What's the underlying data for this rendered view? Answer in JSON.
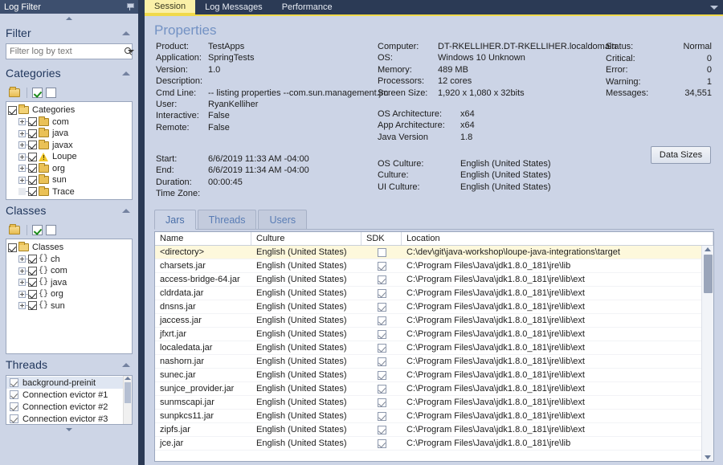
{
  "left_panel": {
    "title": "Log Filter",
    "pin_icon": "pin-icon",
    "sections": {
      "filter": {
        "title": "Filter",
        "search_placeholder": "Filter log by text",
        "search_value": "",
        "search_icon": "magnifier-icon",
        "dropdown_icon": "chevron-down-icon"
      },
      "categories": {
        "title": "Categories",
        "toolbar": {
          "folder_icon": "folder-icon",
          "check_all_icon": "check-all-icon",
          "uncheck_all_icon": "uncheck-all-icon"
        },
        "root": {
          "label": "Categories",
          "checked": true,
          "icon": "folder-open-icon"
        },
        "items": [
          {
            "label": "com",
            "checked": true,
            "icon": "folder-icon",
            "expandable": true
          },
          {
            "label": "java",
            "checked": true,
            "icon": "folder-icon",
            "expandable": true
          },
          {
            "label": "javax",
            "checked": true,
            "icon": "folder-icon",
            "expandable": true
          },
          {
            "label": "Loupe",
            "checked": true,
            "icon": "warning-icon",
            "expandable": true
          },
          {
            "label": "org",
            "checked": true,
            "icon": "folder-icon",
            "expandable": true
          },
          {
            "label": "sun",
            "checked": true,
            "icon": "folder-icon",
            "expandable": true
          },
          {
            "label": "Trace",
            "checked": true,
            "icon": "folder-icon",
            "expandable": false
          }
        ]
      },
      "classes": {
        "title": "Classes",
        "toolbar": {
          "folder_icon": "folder-icon",
          "check_all_icon": "check-all-icon",
          "uncheck_all_icon": "uncheck-all-icon"
        },
        "root": {
          "label": "Classes",
          "checked": true,
          "icon": "folder-open-icon"
        },
        "items": [
          {
            "label": "ch",
            "checked": true,
            "icon": "namespace-icon",
            "expandable": true
          },
          {
            "label": "com",
            "checked": true,
            "icon": "namespace-icon",
            "expandable": true
          },
          {
            "label": "java",
            "checked": true,
            "icon": "namespace-icon",
            "expandable": true
          },
          {
            "label": "org",
            "checked": true,
            "icon": "namespace-icon",
            "expandable": true
          },
          {
            "label": "sun",
            "checked": true,
            "icon": "namespace-icon",
            "expandable": true
          }
        ]
      },
      "threads": {
        "title": "Threads",
        "items": [
          {
            "label": "background-preinit",
            "checked": true,
            "selected": true
          },
          {
            "label": "Connection evictor #1",
            "checked": true,
            "selected": false
          },
          {
            "label": "Connection evictor #2",
            "checked": true,
            "selected": false
          },
          {
            "label": "Connection evictor #3",
            "checked": true,
            "selected": false
          }
        ]
      }
    }
  },
  "tabs": {
    "items": [
      {
        "label": "Session",
        "active": true
      },
      {
        "label": "Log Messages",
        "active": false
      },
      {
        "label": "Performance",
        "active": false
      }
    ],
    "overflow_icon": "chevron-down-icon"
  },
  "properties": {
    "title": "Properties",
    "column1": [
      {
        "key": "Product:",
        "value": "TestApps"
      },
      {
        "key": "Application:",
        "value": "SpringTests"
      },
      {
        "key": "Version:",
        "value": "1.0"
      },
      {
        "key": "Description:",
        "value": ""
      },
      {
        "key": "Cmd Line:",
        "value": "-- listing properties --com.sun.management.jm"
      },
      {
        "key": "User:",
        "value": "RyanKelliher"
      },
      {
        "key": "Interactive:",
        "value": "False"
      },
      {
        "key": "Remote:",
        "value": "False"
      }
    ],
    "column1b": [
      {
        "key": "Start:",
        "value": "6/6/2019 11:33 AM -04:00"
      },
      {
        "key": "End:",
        "value": "6/6/2019 11:34 AM -04:00"
      },
      {
        "key": "Duration:",
        "value": "00:00:45"
      },
      {
        "key": "Time Zone:",
        "value": ""
      }
    ],
    "column2": [
      {
        "key": "Computer:",
        "value": "DT-RKELLIHER.DT-RKELLIHER.localdomain"
      },
      {
        "key": "OS:",
        "value": "Windows 10 Unknown"
      },
      {
        "key": "Memory:",
        "value": "489 MB"
      },
      {
        "key": "Processors:",
        "value": "12 cores"
      },
      {
        "key": "Screen Size:",
        "value": "1,920 x 1,080 x 32bits"
      }
    ],
    "column2b": [
      {
        "key": "OS Architecture:",
        "value": "x64"
      },
      {
        "key": "App Architecture:",
        "value": "x64"
      },
      {
        "key": "Java Version",
        "value": "1.8"
      }
    ],
    "column2c": [
      {
        "key": "OS Culture:",
        "value": "English (United States)"
      },
      {
        "key": "Culture:",
        "value": "English (United States)"
      },
      {
        "key": "UI Culture:",
        "value": "English (United States)"
      }
    ],
    "status_column": [
      {
        "key": "Status:",
        "value": "Normal",
        "warning_icon": false
      },
      {
        "key": "Critical:",
        "value": "0",
        "warning_icon": false
      },
      {
        "key": "Error:",
        "value": "0",
        "warning_icon": false
      },
      {
        "key": "Warning:",
        "value": "1",
        "warning_icon": true
      },
      {
        "key": "Messages:",
        "value": "34,551",
        "warning_icon": false
      }
    ],
    "data_sizes_button": "Data Sizes"
  },
  "inner_tabs": {
    "items": [
      {
        "label": "Jars",
        "active": true
      },
      {
        "label": "Threads",
        "active": false
      },
      {
        "label": "Users",
        "active": false
      }
    ]
  },
  "grid": {
    "columns": [
      "Name",
      "Culture",
      "SDK",
      "Location"
    ],
    "rows": [
      {
        "name": "<directory>",
        "culture": "English (United States)",
        "sdk": false,
        "location": "C:\\dev\\git\\java-workshop\\loupe-java-integrations\\target",
        "selected": true
      },
      {
        "name": "charsets.jar",
        "culture": "English (United States)",
        "sdk": true,
        "location": "C:\\Program Files\\Java\\jdk1.8.0_181\\jre\\lib",
        "selected": false
      },
      {
        "name": "access-bridge-64.jar",
        "culture": "English (United States)",
        "sdk": true,
        "location": "C:\\Program Files\\Java\\jdk1.8.0_181\\jre\\lib\\ext",
        "selected": false
      },
      {
        "name": "cldrdata.jar",
        "culture": "English (United States)",
        "sdk": true,
        "location": "C:\\Program Files\\Java\\jdk1.8.0_181\\jre\\lib\\ext",
        "selected": false
      },
      {
        "name": "dnsns.jar",
        "culture": "English (United States)",
        "sdk": true,
        "location": "C:\\Program Files\\Java\\jdk1.8.0_181\\jre\\lib\\ext",
        "selected": false
      },
      {
        "name": "jaccess.jar",
        "culture": "English (United States)",
        "sdk": true,
        "location": "C:\\Program Files\\Java\\jdk1.8.0_181\\jre\\lib\\ext",
        "selected": false
      },
      {
        "name": "jfxrt.jar",
        "culture": "English (United States)",
        "sdk": true,
        "location": "C:\\Program Files\\Java\\jdk1.8.0_181\\jre\\lib\\ext",
        "selected": false
      },
      {
        "name": "localedata.jar",
        "culture": "English (United States)",
        "sdk": true,
        "location": "C:\\Program Files\\Java\\jdk1.8.0_181\\jre\\lib\\ext",
        "selected": false
      },
      {
        "name": "nashorn.jar",
        "culture": "English (United States)",
        "sdk": true,
        "location": "C:\\Program Files\\Java\\jdk1.8.0_181\\jre\\lib\\ext",
        "selected": false
      },
      {
        "name": "sunec.jar",
        "culture": "English (United States)",
        "sdk": true,
        "location": "C:\\Program Files\\Java\\jdk1.8.0_181\\jre\\lib\\ext",
        "selected": false
      },
      {
        "name": "sunjce_provider.jar",
        "culture": "English (United States)",
        "sdk": true,
        "location": "C:\\Program Files\\Java\\jdk1.8.0_181\\jre\\lib\\ext",
        "selected": false
      },
      {
        "name": "sunmscapi.jar",
        "culture": "English (United States)",
        "sdk": true,
        "location": "C:\\Program Files\\Java\\jdk1.8.0_181\\jre\\lib\\ext",
        "selected": false
      },
      {
        "name": "sunpkcs11.jar",
        "culture": "English (United States)",
        "sdk": true,
        "location": "C:\\Program Files\\Java\\jdk1.8.0_181\\jre\\lib\\ext",
        "selected": false
      },
      {
        "name": "zipfs.jar",
        "culture": "English (United States)",
        "sdk": true,
        "location": "C:\\Program Files\\Java\\jdk1.8.0_181\\jre\\lib\\ext",
        "selected": false
      },
      {
        "name": "jce.jar",
        "culture": "English (United States)",
        "sdk": true,
        "location": "C:\\Program Files\\Java\\jdk1.8.0_181\\jre\\lib",
        "selected": false
      }
    ]
  },
  "colors": {
    "window_chrome": "#2b3a55",
    "panel_bg": "#ccd4e6",
    "active_tab": "#faf0a8",
    "accent_underline": "#f0d94a",
    "title_text": "#7392c4",
    "selected_row": "#fdf8dc",
    "warning": "#f2c829"
  }
}
